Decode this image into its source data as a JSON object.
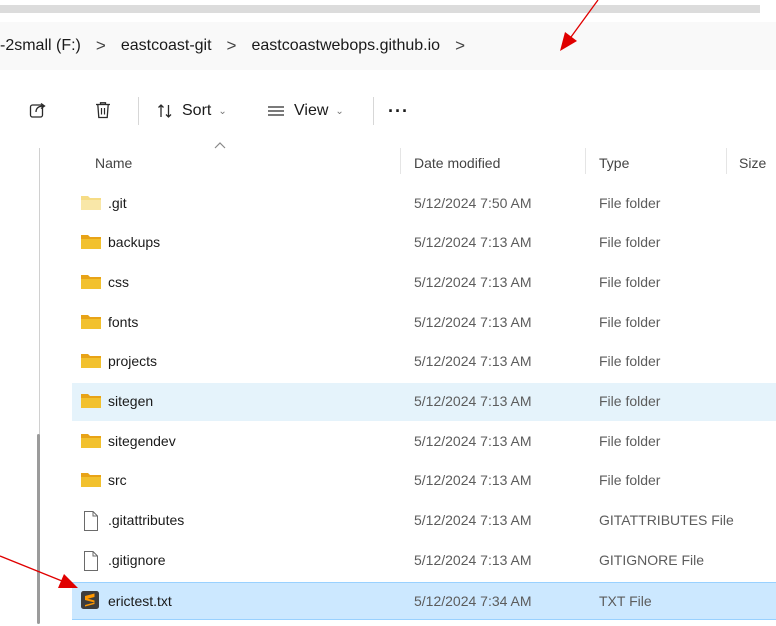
{
  "breadcrumb": {
    "items": [
      "-2small (F:)",
      "eastcoast-git",
      "eastcoastwebops.github.io"
    ],
    "separator": ">"
  },
  "toolbar": {
    "sort_label": "Sort",
    "view_label": "View",
    "more_label": "···",
    "dropdown_glyph": "⌄"
  },
  "columns": {
    "name": "Name",
    "date": "Date modified",
    "type": "Type",
    "size": "Size"
  },
  "files": [
    {
      "name": ".git",
      "date": "5/12/2024 7:50 AM",
      "type": "File folder",
      "kind": "folder-light"
    },
    {
      "name": "backups",
      "date": "5/12/2024 7:13 AM",
      "type": "File folder",
      "kind": "folder"
    },
    {
      "name": "css",
      "date": "5/12/2024 7:13 AM",
      "type": "File folder",
      "kind": "folder"
    },
    {
      "name": "fonts",
      "date": "5/12/2024 7:13 AM",
      "type": "File folder",
      "kind": "folder"
    },
    {
      "name": "projects",
      "date": "5/12/2024 7:13 AM",
      "type": "File folder",
      "kind": "folder"
    },
    {
      "name": "sitegen",
      "date": "5/12/2024 7:13 AM",
      "type": "File folder",
      "kind": "folder"
    },
    {
      "name": "sitegendev",
      "date": "5/12/2024 7:13 AM",
      "type": "File folder",
      "kind": "folder"
    },
    {
      "name": "src",
      "date": "5/12/2024 7:13 AM",
      "type": "File folder",
      "kind": "folder"
    },
    {
      "name": ".gitattributes",
      "date": "5/12/2024 7:13 AM",
      "type": "GITATTRIBUTES File",
      "kind": "file"
    },
    {
      "name": ".gitignore",
      "date": "5/12/2024 7:13 AM",
      "type": "GITIGNORE File",
      "kind": "file"
    },
    {
      "name": "erictest.txt",
      "date": "5/12/2024 7:34 AM",
      "type": "TXT File",
      "kind": "sublime"
    }
  ],
  "state": {
    "hover_row": "sitegen",
    "selected_row": "erictest.txt"
  },
  "colors": {
    "folder": "#f2c12e",
    "folder_light": "#f6dc85",
    "arrow": "#e00000",
    "hover": "#e5f3fb",
    "selected": "#cce8ff"
  },
  "icons": {
    "share": "share-icon",
    "delete": "trash-icon",
    "sort": "sort-arrows-icon",
    "view": "view-lines-icon",
    "folder": "folder-icon",
    "file": "document-icon",
    "sublime": "sublime-text-icon"
  }
}
